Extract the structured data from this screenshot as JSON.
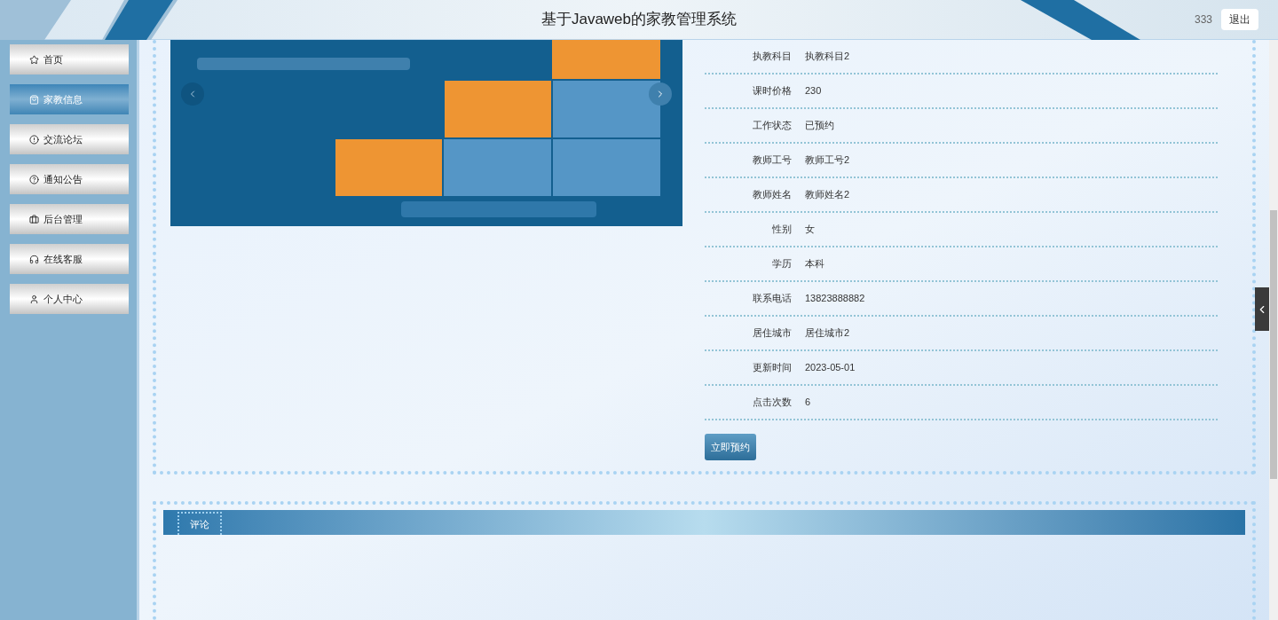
{
  "header": {
    "title": "基于Javaweb的家教管理系统",
    "user": "333",
    "logout": "退出"
  },
  "nav": [
    {
      "label": "首页",
      "selected": false
    },
    {
      "label": "家教信息",
      "selected": true
    },
    {
      "label": "交流论坛",
      "selected": false
    },
    {
      "label": "通知公告",
      "selected": false
    },
    {
      "label": "后台管理",
      "selected": false
    },
    {
      "label": "在线客服",
      "selected": false
    },
    {
      "label": "个人中心",
      "selected": false
    }
  ],
  "details": [
    {
      "label": "执教科目",
      "value": "执教科目2"
    },
    {
      "label": "课时价格",
      "value": "230"
    },
    {
      "label": "工作状态",
      "value": "已预约"
    },
    {
      "label": "教师工号",
      "value": "教师工号2"
    },
    {
      "label": "教师姓名",
      "value": "教师姓名2"
    },
    {
      "label": "性别",
      "value": "女"
    },
    {
      "label": "学历",
      "value": "本科"
    },
    {
      "label": "联系电话",
      "value": "13823888882"
    },
    {
      "label": "居住城市",
      "value": "居住城市2"
    },
    {
      "label": "更新时间",
      "value": "2023-05-01"
    },
    {
      "label": "点击次数",
      "value": "6"
    }
  ],
  "book_button": "立即预约",
  "comments": {
    "tab": "评论"
  }
}
